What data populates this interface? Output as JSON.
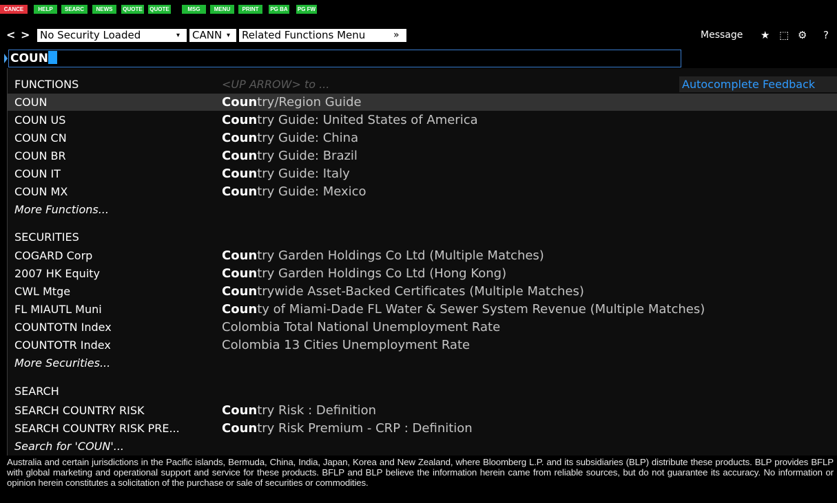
{
  "keys": [
    {
      "label": "CANCE",
      "color": "#e0303a"
    },
    {
      "label": "HELP",
      "color": "#1fb735"
    },
    {
      "label": "SEARC",
      "color": "#1fb735"
    },
    {
      "label": "NEWS",
      "color": "#1fb735"
    },
    {
      "label": "QUOTE",
      "color": "#1fb735"
    },
    {
      "label": "QUOTE",
      "color": "#1fb735"
    },
    {
      "label": "MSG",
      "color": "#1fb735"
    },
    {
      "label": "MENU",
      "color": "#1fb735"
    },
    {
      "label": "PRINT",
      "color": "#1fb735"
    },
    {
      "label": "PG BA",
      "color": "#1fb735"
    },
    {
      "label": "PG FW",
      "color": "#1fb735"
    }
  ],
  "toolbar": {
    "back_icon": "chevron-left-icon",
    "forward_icon": "chevron-right-icon",
    "back_label": "<",
    "forward_label": ">",
    "security": "No Security Loaded",
    "language": "CANN",
    "related_menu": "Related Functions Menu",
    "related_caret": "»",
    "dropdown_caret": "▾",
    "message_label": "Message",
    "star_icon": "star-icon",
    "star_glyph": "★",
    "export_icon": "export-icon",
    "export_glyph": "⬚",
    "gear_icon": "gear-icon",
    "gear_glyph": "⚙",
    "help_glyph": "?"
  },
  "command": {
    "value": "COUN"
  },
  "autocomplete": {
    "hint": "<UP ARROW> to ...",
    "feedback": "Autocomplete Feedback",
    "functions": {
      "header": "FUNCTIONS",
      "items": [
        {
          "code": "COUN",
          "match": "Coun",
          "rest": "try/Region Guide"
        },
        {
          "code": "COUN US",
          "match": "Coun",
          "rest": "try Guide: United States of America"
        },
        {
          "code": "COUN CN",
          "match": "Coun",
          "rest": "try Guide: China"
        },
        {
          "code": "COUN BR",
          "match": "Coun",
          "rest": "try Guide: Brazil"
        },
        {
          "code": "COUN IT",
          "match": "Coun",
          "rest": "try Guide: Italy"
        },
        {
          "code": "COUN MX",
          "match": "Coun",
          "rest": "try Guide: Mexico"
        }
      ],
      "more": "More Functions..."
    },
    "securities": {
      "header": "SECURITIES",
      "items": [
        {
          "code": "COGARD Corp",
          "match": "Coun",
          "rest": "try Garden Holdings Co Ltd (Multiple Matches)"
        },
        {
          "code": "2007 HK Equity",
          "match": "Coun",
          "rest": "try Garden Holdings Co Ltd (Hong Kong)"
        },
        {
          "code": "CWL Mtge",
          "match": "Coun",
          "rest": "trywide Asset-Backed Certificates (Multiple Matches)"
        },
        {
          "code": "FL MIAUTL Muni",
          "match": "Coun",
          "rest": "ty of Miami-Dade FL Water & Sewer System Revenue (Multiple Matches)"
        },
        {
          "code": "COUNTOTN Index",
          "match": "",
          "rest": "Colombia Total National Unemployment Rate"
        },
        {
          "code": "COUNTOTR Index",
          "match": "",
          "rest": "Colombia 13 Cities Unemployment Rate"
        }
      ],
      "more": "More Securities..."
    },
    "search": {
      "header": "SEARCH",
      "items": [
        {
          "code": "SEARCH COUNTRY RISK",
          "match": "Coun",
          "rest": "try Risk : Definition"
        },
        {
          "code": "SEARCH COUNTRY RISK PRE...",
          "match": "Coun",
          "rest": "try Risk Premium - CRP : Definition"
        }
      ],
      "more": "Search for 'COUN'..."
    }
  },
  "disclaimer": "Australia and certain jurisdictions in the Pacific islands, Bermuda, China, India, Japan, Korea and New Zealand, where Bloomberg L.P. and its subsidiaries (BLP) distribute these products. BLP provides BFLP with global marketing and operational support and service for these products. BFLP and BLP believe the information herein came from reliable sources, but do not guarantee its accuracy. No information or opinion herein constitutes a solicitation of the purchase or sale of securities or commodities."
}
